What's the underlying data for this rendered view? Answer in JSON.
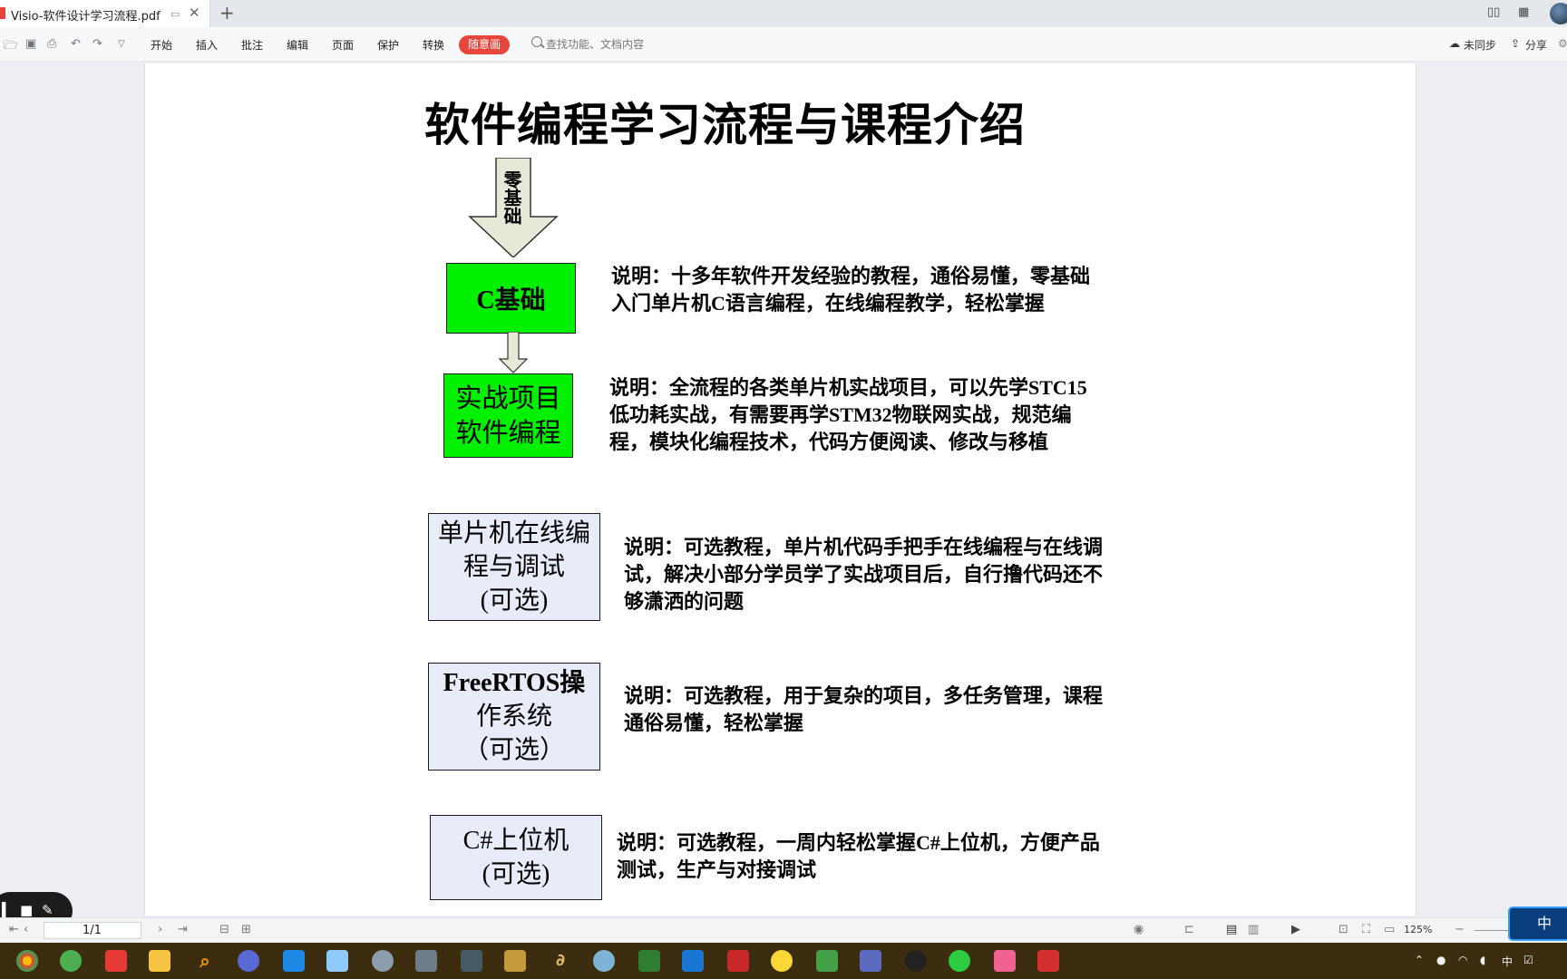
{
  "app": {
    "tab_title": "Visio-软件设计学习流程.pdf"
  },
  "toolbar": {
    "menus": [
      "开始",
      "插入",
      "批注",
      "编辑",
      "页面",
      "保护",
      "转换"
    ],
    "special": "随意画",
    "search_placeholder": "查找功能、文档内容",
    "sync": "未同步",
    "share": "分享"
  },
  "document": {
    "title": "软件编程学习流程与课程介绍",
    "arrow_label": "零基础",
    "steps": [
      {
        "label_lines": [
          "C基础"
        ],
        "desc_lines": [
          "说明：十多年软件开发经验的教程，通俗易懂，零基础",
          "入门单片机C语言编程，在线编程教学，轻松掌握"
        ]
      },
      {
        "label_lines": [
          "实战项目",
          "软件编程"
        ],
        "desc_lines": [
          "说明：全流程的各类单片机实战项目，可以先学STC15",
          "低功耗实战，有需要再学STM32物联网实战，规范编",
          "程，模块化编程技术，代码方便阅读、修改与移植"
        ]
      },
      {
        "label_lines": [
          "单片机在线编",
          "程与调试",
          "(可选)"
        ],
        "desc_lines": [
          "说明：可选教程，单片机代码手把手在线编程与在线调",
          "试，解决小部分学员学了实战项目后，自行撸代码还不",
          "够潇洒的问题"
        ]
      },
      {
        "label_lines": [
          "FreeRTOS操",
          "作系统",
          "（可选）"
        ],
        "desc_lines": [
          "说明：可选教程，用于复杂的项目，多任务管理，课程",
          "通俗易懂，轻松掌握"
        ]
      },
      {
        "label_lines": [
          "C#上位机",
          "(可选)"
        ],
        "desc_lines": [
          "说明：可选教程，一周内轻松掌握C#上位机，方便产品",
          "测试，生产与对接调试"
        ]
      }
    ]
  },
  "statusbar": {
    "page_indicator": "1/1",
    "zoom": "125%"
  },
  "ime": {
    "mode": "中"
  },
  "taskbar": {
    "tray_lang": "中"
  },
  "colors": {
    "step_green": "#00f000",
    "step_optional": "#e8ecf8",
    "accent_red": "#e8453c",
    "taskbar": "#3d2d10"
  }
}
